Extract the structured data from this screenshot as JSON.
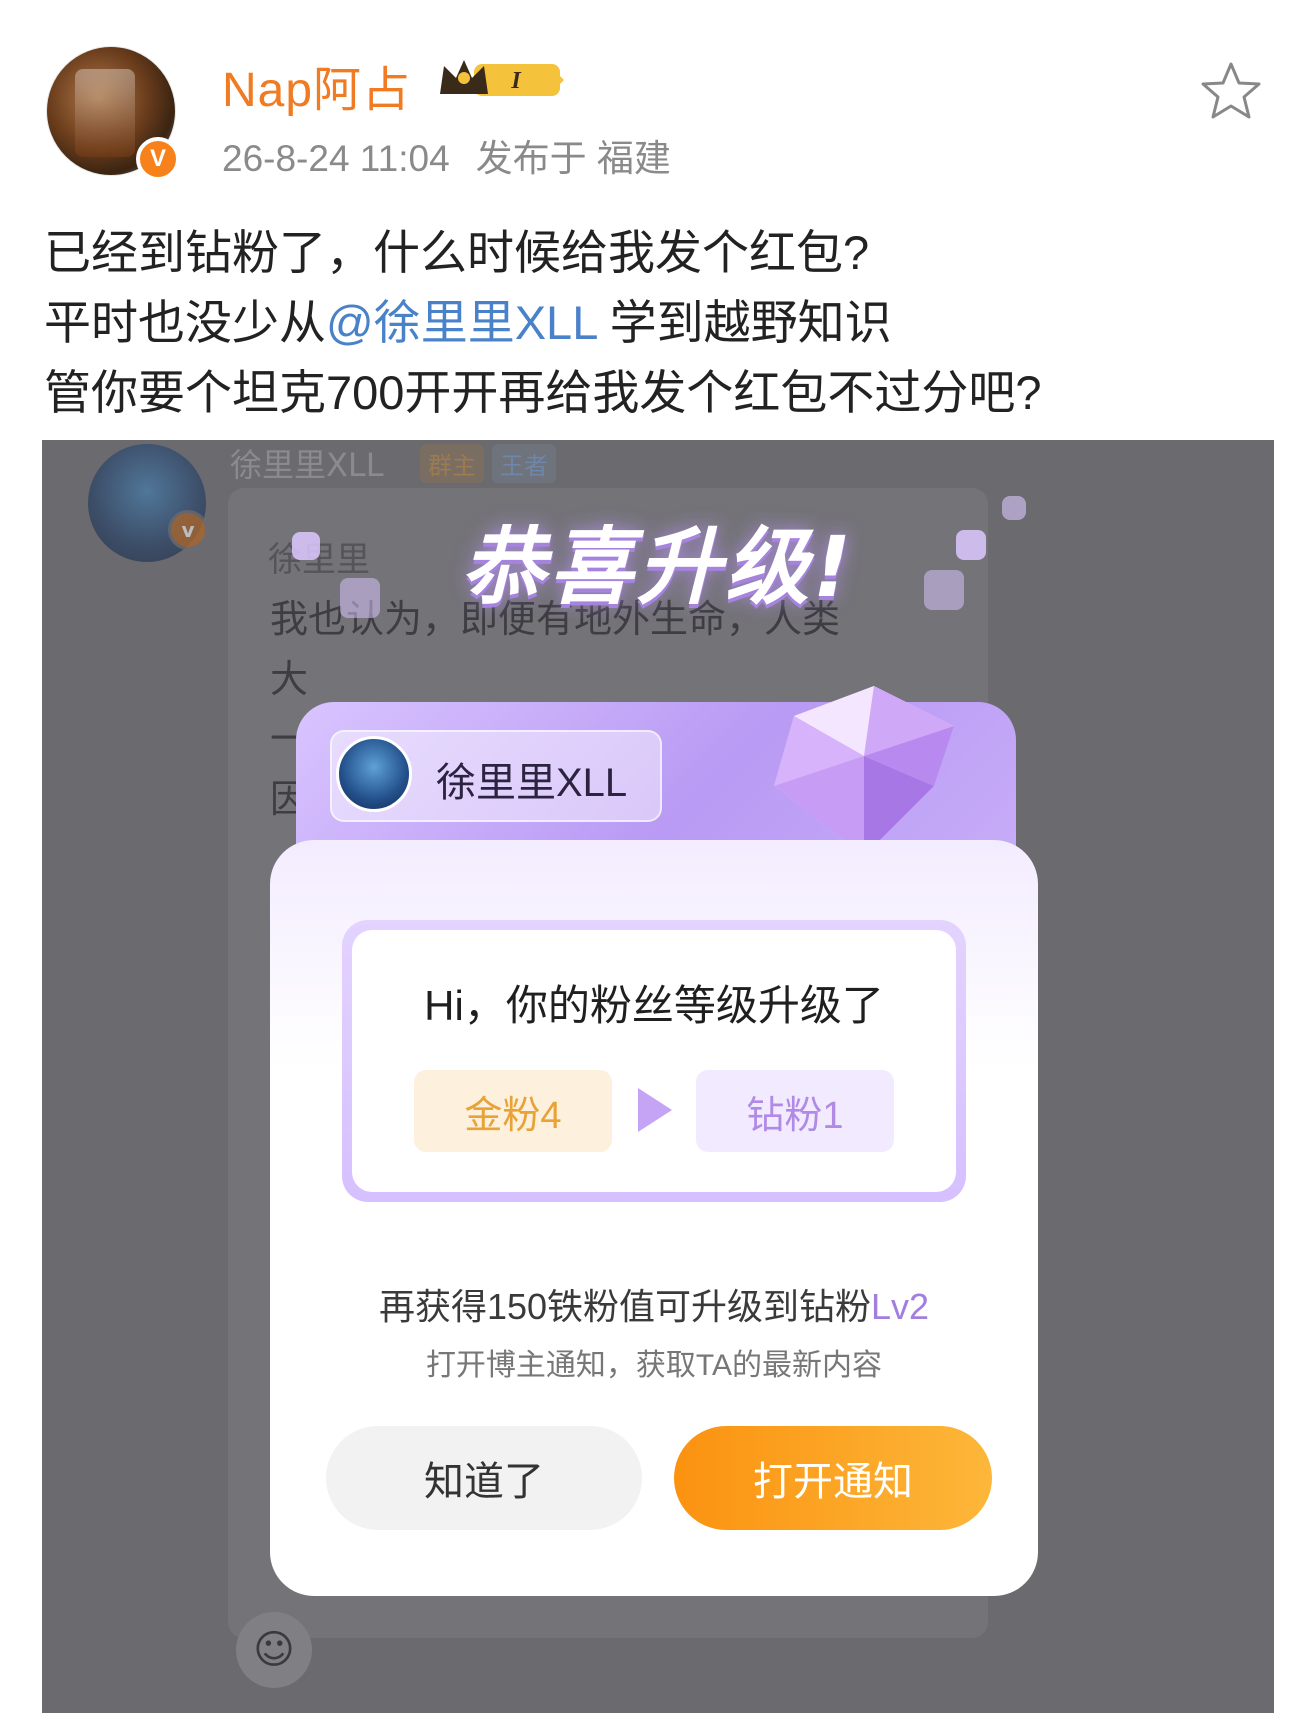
{
  "post": {
    "username": "Nap阿占",
    "level_badge": "I",
    "timestamp": "26-8-24 11:04",
    "location": "发布于 福建",
    "verified_badge": "V",
    "text_lines": [
      "已经到钻粉了，什么时候给我发个红包?",
      "平时也没少从",
      "@徐里里XLL",
      " 学到越野知识",
      "管你要个坦克700开开再给我发个红包不过分吧?"
    ]
  },
  "screenshot": {
    "bg": {
      "name": "徐里里XLL",
      "tag_owner": "群主",
      "tag_king": "王者",
      "inner_name": "徐里里",
      "lines": [
        "我也认为，即便有地外生命，人类",
        "大",
        "一",
        "因"
      ]
    },
    "congrats_title": "恭喜升级!",
    "chip_name": "徐里里XLL",
    "greeting": "Hi，你的粉丝等级升级了",
    "level_from": "金粉4",
    "level_to": "钻粉1",
    "info_main": "再获得150铁粉值可升级到钻粉",
    "info_level": "Lv2",
    "info_sub": "打开博主通知，获取TA的最新内容",
    "btn_know": "知道了",
    "btn_open": "打开通知"
  },
  "colors": {
    "username": "#f07b22",
    "mention": "#4a82c9",
    "open_button": "#fb9210",
    "accent_purple": "#b18ae6"
  }
}
